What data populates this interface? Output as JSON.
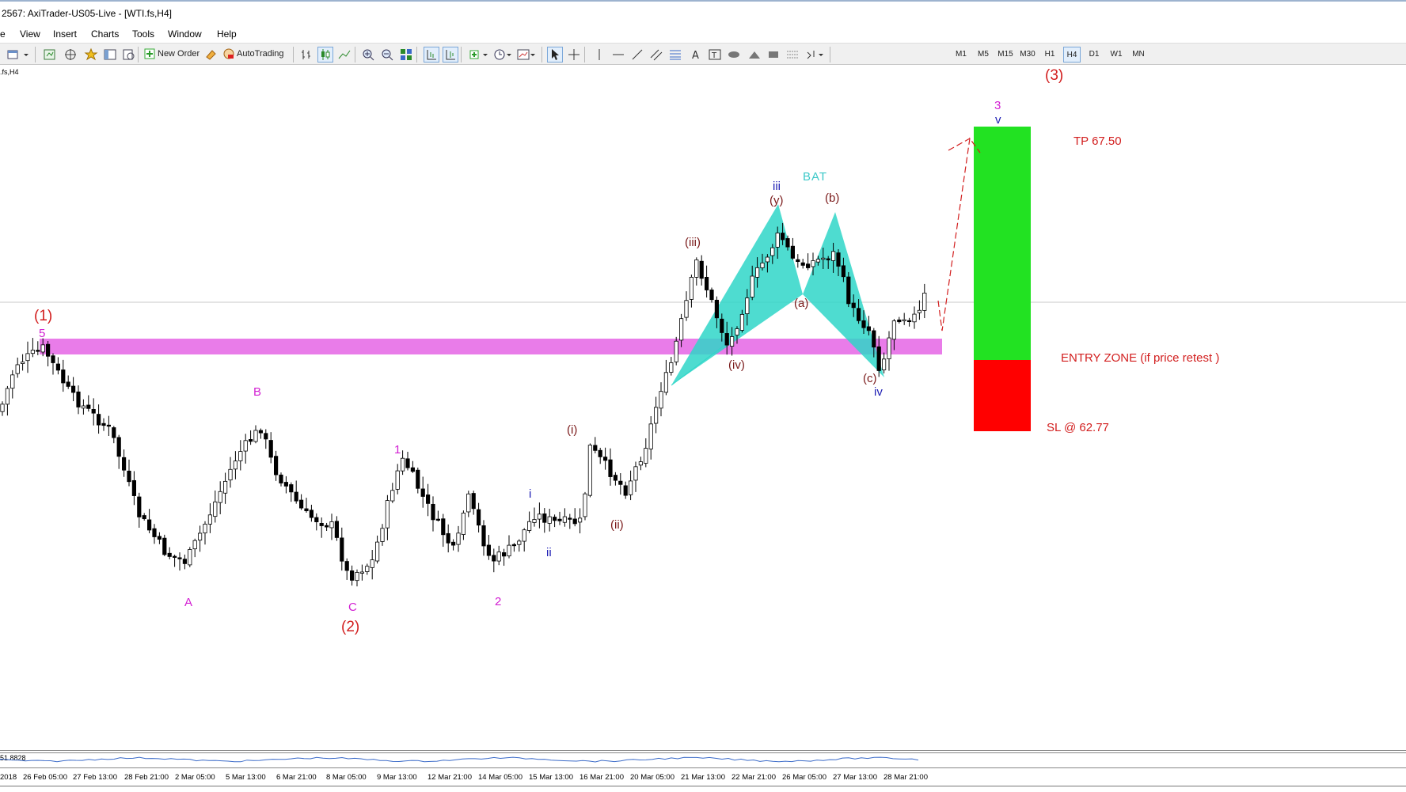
{
  "window": {
    "title": "2567: AxiTrader-US05-Live - [WTI.fs,H4]"
  },
  "menu": [
    "e",
    "View",
    "Insert",
    "Charts",
    "Tools",
    "Window",
    "Help"
  ],
  "toolbar": {
    "new_order": "New Order",
    "auto_trading": "AutoTrading",
    "timeframes": [
      "M1",
      "M5",
      "M15",
      "M30",
      "H1",
      "H4",
      "D1",
      "W1",
      "MN"
    ],
    "active_timeframe": "H4"
  },
  "chart": {
    "symbol_label": ".fs,H4",
    "indicator_value": "51.8828",
    "colors": {
      "wave_red": "#d21e1e",
      "wave_magenta": "#d21ed2",
      "wave_blue": "#1e1eb4",
      "wave_brown": "#7a1a1a",
      "pattern": "#2fd6c8",
      "zone": "#e97ce9",
      "target": "#22e222",
      "stop": "#ff0000",
      "bat_text": "#3cc8c8"
    },
    "labels": {
      "w1": "(1)",
      "w2": "(2)",
      "w3": "(3)",
      "five": "5",
      "A": "A",
      "B": "B",
      "C": "C",
      "one": "1",
      "two": "2",
      "three": "3",
      "i": "i",
      "ii": "ii",
      "iii": "iii",
      "iv": "iv",
      "v": "v",
      "pi": "(i)",
      "pii": "(ii)",
      "piii": "(iii)",
      "piv": "(iv)",
      "py": "(y)",
      "pb": "(b)",
      "pa": "(a)",
      "pc": "(c)",
      "bat": "BAT",
      "tp": "TP 67.50",
      "entry": "ENTRY ZONE  (if price retest )",
      "sl": "SL @ 62.77"
    },
    "x_axis": [
      "2018",
      "26 Feb 05:00",
      "27 Feb 13:00",
      "28 Feb 21:00",
      "2 Mar 05:00",
      "5 Mar 13:00",
      "6 Mar 21:00",
      "8 Mar 05:00",
      "9 Mar 13:00",
      "12 Mar 21:00",
      "14 Mar 05:00",
      "15 Mar 13:00",
      "16 Mar 21:00",
      "20 Mar 05:00",
      "21 Mar 13:00",
      "22 Mar 21:00",
      "26 Mar 05:00",
      "27 Mar 13:00",
      "28 Mar 21:00"
    ]
  }
}
